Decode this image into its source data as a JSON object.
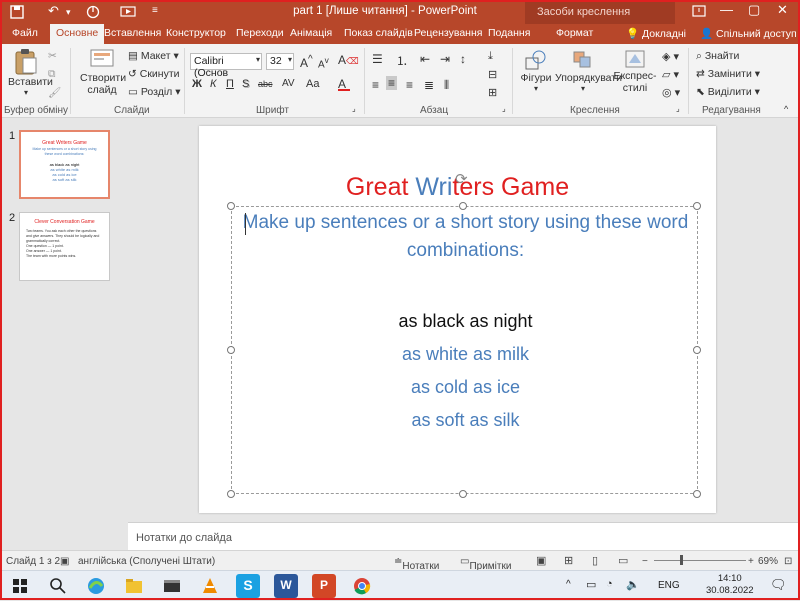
{
  "titlebar": {
    "title": "part 1 [Лише читання] - PowerPoint",
    "context_tools": "Засоби креслення"
  },
  "tabs": [
    {
      "label": "Файл"
    },
    {
      "label": "Основне"
    },
    {
      "label": "Вставлення"
    },
    {
      "label": "Конструктор"
    },
    {
      "label": "Переходи"
    },
    {
      "label": "Анімація"
    },
    {
      "label": "Показ слайдів"
    },
    {
      "label": "Рецензування"
    },
    {
      "label": "Подання"
    },
    {
      "label": "Формат"
    }
  ],
  "tell_me": "Докладні",
  "share": "Спільний доступ",
  "ribbon": {
    "paste": "Вставити",
    "new_slide": "Створити слайд",
    "layout": "Макет",
    "reset": "Скинути",
    "section": "Розділ",
    "font_name": "Calibri (Основ",
    "font_size": "32",
    "shapes": "Фігури",
    "arrange": "Упорядкувати",
    "quick_styles": "Експрес-стилі",
    "find": "Знайти",
    "replace": "Замінити",
    "select": "Виділити",
    "groups": {
      "clipboard": "Буфер обміну",
      "slides": "Слайди",
      "font": "Шрифт",
      "paragraph": "Абзац",
      "drawing": "Креслення",
      "editing": "Редагування"
    },
    "font_buttons": [
      "Ж",
      "К",
      "П",
      "S",
      "abc"
    ]
  },
  "thumbnails": [
    {
      "num": "1",
      "title": "Great Writers Game",
      "sub": "Make up sentences or a short story using these word combinations:",
      "lines": [
        "as black as night",
        "as white as milk",
        "as cold as ice",
        "as soft as silk"
      ]
    },
    {
      "num": "2",
      "title": "Clever Conversation Game",
      "lines": [
        "Two teams. You ask each other the questions",
        "and give answers. They should be logically and",
        "grammatically correct.",
        "One question — 1 point.",
        "One answer — 1 point.",
        "The team with more points wins."
      ]
    }
  ],
  "slide": {
    "title_part1": "Great ",
    "title_part2": "Wri",
    "title_part3": "ters Game",
    "instruction": "Make up sentences or a short story using these word combinations:",
    "phrases": [
      "as black as night",
      "as white as milk",
      "as cold as ice",
      "as soft as silk"
    ]
  },
  "notes_placeholder": "Нотатки до слайда",
  "status": {
    "slide_of": "Слайд 1 з 2",
    "language": "англійська (Сполучені Штати)",
    "notes": "Нотатки",
    "comments": "Примітки",
    "zoom": "69%"
  },
  "taskbar": {
    "lang": "ENG",
    "time": "14:10",
    "date": "30.08.2022"
  },
  "colors": {
    "accent": "#b7472a",
    "title_red": "#e02020",
    "title_blue": "#4a7ebb",
    "phrase_blue": "#4a7ebb"
  }
}
